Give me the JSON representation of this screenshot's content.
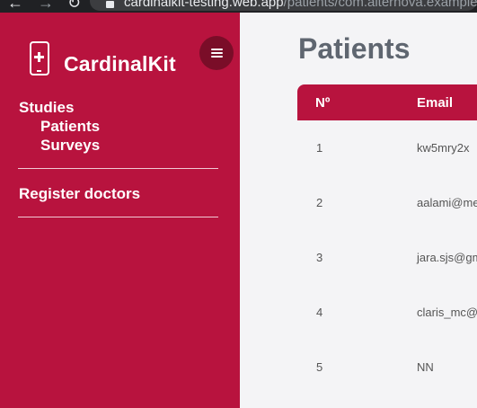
{
  "browser": {
    "url_host": "cardinalkit-testing.web.app",
    "url_path": "/patients/com.alternova.example"
  },
  "sidebar": {
    "brand": "CardinalKit",
    "nav": {
      "studies": "Studies",
      "patients": "Patients",
      "surveys": "Surveys",
      "register_doctors": "Register doctors"
    }
  },
  "main": {
    "title": "Patients",
    "table": {
      "columns": [
        "Nº",
        "Email"
      ],
      "rows": [
        {
          "no": "1",
          "email": "kw5mry2x"
        },
        {
          "no": "2",
          "email": "aalami@me"
        },
        {
          "no": "3",
          "email": "jara.sjs@gm"
        },
        {
          "no": "4",
          "email": "claris_mc@"
        },
        {
          "no": "5",
          "email": "NN"
        }
      ]
    }
  },
  "colors": {
    "brand": "#b8133e",
    "toggle": "#7a0d28",
    "title": "#5f6670"
  },
  "icons": [
    "back-arrow-icon",
    "forward-arrow-icon",
    "reload-icon",
    "lock-icon",
    "phone-medical-icon",
    "hamburger-menu-icon"
  ]
}
